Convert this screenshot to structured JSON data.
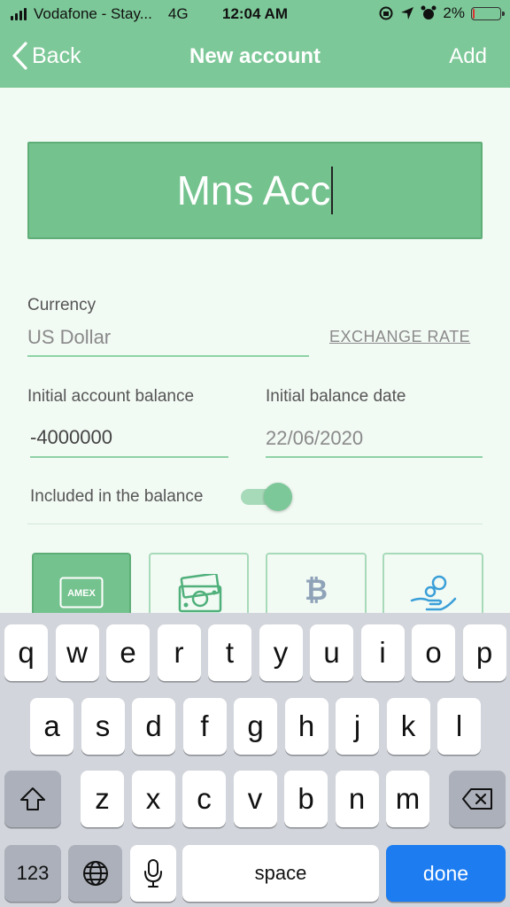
{
  "status_bar": {
    "carrier": "Vodafone - Stay...",
    "network": "4G",
    "time": "12:04 AM",
    "battery": "2%"
  },
  "nav": {
    "back_label": "Back",
    "title": "New account",
    "add_label": "Add"
  },
  "account_name": {
    "value": "Mns Acc"
  },
  "currency": {
    "label": "Currency",
    "value": "US Dollar",
    "exchange_rate_link": "EXCHANGE RATE"
  },
  "initial_balance": {
    "label": "Initial account balance",
    "value": "-4000000"
  },
  "initial_date": {
    "label": "Initial balance date",
    "value": "22/06/2020"
  },
  "included_toggle": {
    "label": "Included in the balance",
    "on": true
  },
  "account_types": [
    {
      "icon": "amex-card-icon",
      "label": "AMEX",
      "selected": true
    },
    {
      "icon": "cash-icon",
      "selected": false
    },
    {
      "icon": "bitcoin-icon",
      "label": "₿",
      "selected": false
    },
    {
      "icon": "hand-coins-icon",
      "selected": false
    }
  ],
  "keyboard": {
    "row1": [
      "q",
      "w",
      "e",
      "r",
      "t",
      "y",
      "u",
      "i",
      "o",
      "p"
    ],
    "row2": [
      "a",
      "s",
      "d",
      "f",
      "g",
      "h",
      "j",
      "k",
      "l"
    ],
    "row3": [
      "z",
      "x",
      "c",
      "v",
      "b",
      "n",
      "m"
    ],
    "numbers_key": "123",
    "space_key": "space",
    "done_key": "done"
  },
  "colors": {
    "primary_green": "#7dc898",
    "done_blue": "#1c7cf0"
  }
}
